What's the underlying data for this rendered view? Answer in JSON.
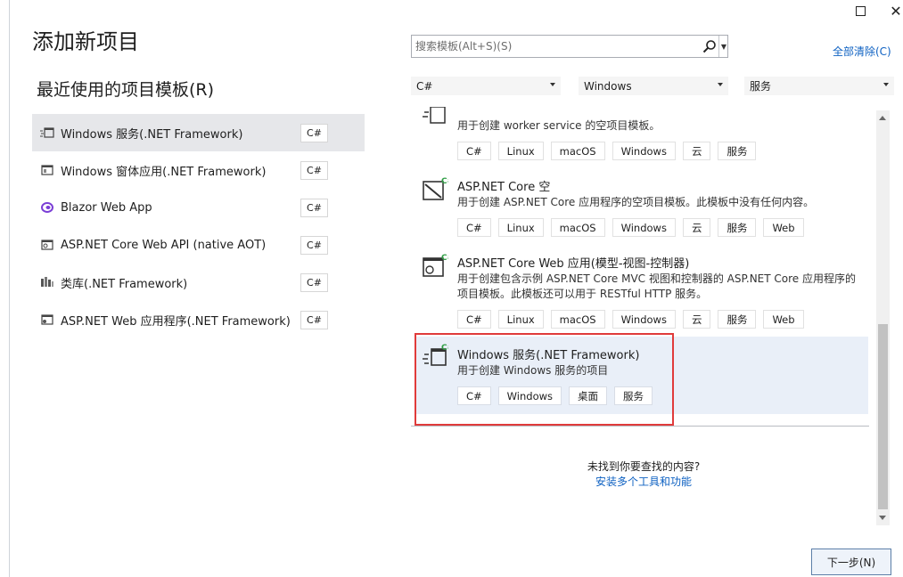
{
  "page": {
    "title": "添加新项目",
    "recent_title": "最近使用的项目模板(R)"
  },
  "recent": [
    {
      "label": "Windows 服务(.NET Framework)",
      "lang": "C#",
      "icon": "windows-service-icon",
      "selected": true
    },
    {
      "label": "Windows 窗体应用(.NET Framework)",
      "lang": "C#",
      "icon": "windows-forms-icon",
      "selected": false
    },
    {
      "label": "Blazor Web App",
      "lang": "C#",
      "icon": "blazor-icon",
      "selected": false
    },
    {
      "label": "ASP.NET Core Web API (native AOT)",
      "lang": "C#",
      "icon": "web-api-icon",
      "selected": false
    },
    {
      "label": "类库(.NET Framework)",
      "lang": "C#",
      "icon": "class-library-icon",
      "selected": false
    },
    {
      "label": "ASP.NET Web 应用程序(.NET Framework)",
      "lang": "C#",
      "icon": "web-app-icon",
      "selected": false
    }
  ],
  "search": {
    "placeholder": "搜索模板(Alt+S)(S)"
  },
  "clear_all": "全部清除(C)",
  "filters": {
    "language": "C#",
    "platform": "Windows",
    "project_type": "服务"
  },
  "templates": [
    {
      "name": "",
      "desc": "用于创建 worker service 的空项目模板。",
      "tags": [
        "C#",
        "Linux",
        "macOS",
        "Windows",
        "云",
        "服务"
      ],
      "icon": "worker-service-icon"
    },
    {
      "name": "ASP.NET Core 空",
      "desc": "用于创建 ASP.NET Core 应用程序的空项目模板。此模板中没有任何内容。",
      "tags": [
        "C#",
        "Linux",
        "macOS",
        "Windows",
        "云",
        "服务",
        "Web"
      ],
      "icon": "aspnet-empty-icon"
    },
    {
      "name": "ASP.NET Core Web 应用(模型-视图-控制器)",
      "desc": "用于创建包含示例 ASP.NET Core MVC 视图和控制器的 ASP.NET Core 应用程序的项目模板。此模板还可以用于 RESTful HTTP 服务。",
      "tags": [
        "C#",
        "Linux",
        "macOS",
        "Windows",
        "云",
        "服务",
        "Web"
      ],
      "icon": "aspnet-mvc-icon"
    },
    {
      "name": "Windows 服务(.NET Framework)",
      "desc": "用于创建 Windows 服务的项目",
      "tags": [
        "C#",
        "Windows",
        "桌面",
        "服务"
      ],
      "icon": "windows-service-icon",
      "selected": true
    }
  ],
  "not_found": {
    "question": "未找到你要查找的内容?",
    "link": "安装多个工具和功能"
  },
  "next_button": "下一步(N)",
  "colors": {
    "link": "#0e61c2",
    "selected_bg": "#e9eff8",
    "highlight": "#e03b3b",
    "accent_green": "#2f9e44"
  }
}
